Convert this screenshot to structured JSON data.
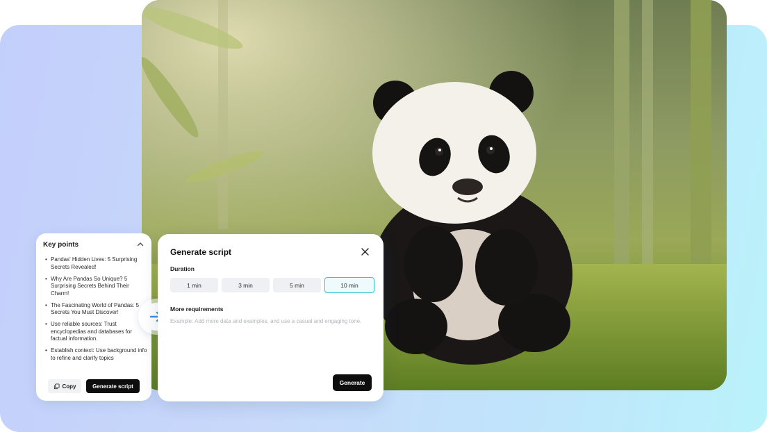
{
  "key_points": {
    "title": "Key points",
    "items": [
      "Pandas' Hidden Lives: 5 Surprising Secrets Revealed!",
      "Why Are Pandas So Unique? 5 Surprising Secrets Behind Their Charm!",
      "The Fascinating World of Pandas: 5 Secrets You Must Discover!",
      "Use reliable sources: Trust encyclopedias and databases for factual information.",
      "Establish context: Use background info to refine and clarify topics"
    ],
    "copy_label": "Copy",
    "generate_script_label": "Generate script"
  },
  "dialog": {
    "title": "Generate script",
    "duration_label": "Duration",
    "durations": [
      "1 min",
      "3 min",
      "5 min",
      "10 min"
    ],
    "selected_duration": "10 min",
    "more_requirements_label": "More requirements",
    "requirements_placeholder": "Example: Add more data and examples, and use a casual and engaging tone.",
    "generate_label": "Generate"
  },
  "icons": {
    "collapse": "chevron-up-icon",
    "copy": "copy-icon",
    "arrow": "arrow-right-icon",
    "close": "close-icon"
  },
  "colors": {
    "accent_teal": "#3bc1cf",
    "arrow_blue": "#3a8ef0",
    "primary_button": "#0d0d0d"
  }
}
